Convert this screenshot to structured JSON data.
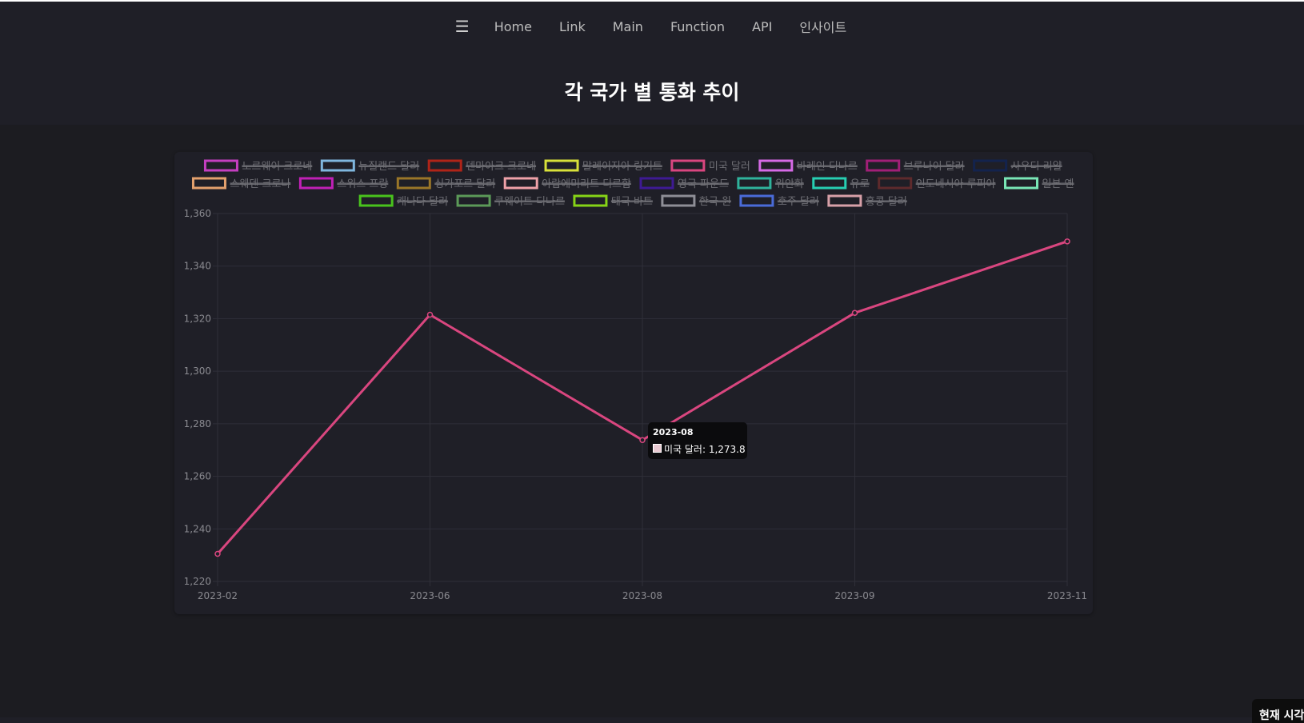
{
  "nav": {
    "menu_icon": "hamburger-menu-icon",
    "items": [
      "Home",
      "Link",
      "Main",
      "Function",
      "API",
      "인사이트"
    ]
  },
  "page": {
    "title": "각 국가 별 통화 추이"
  },
  "tooltip": {
    "title": "2023-08",
    "label": "미국 달러: 1,273.8"
  },
  "clock": {
    "label": "현재 시각"
  },
  "chart_data": {
    "type": "line",
    "x": [
      "2023-02",
      "2023-06",
      "2023-08",
      "2023-09",
      "2023-11"
    ],
    "ylim": [
      1220,
      1360
    ],
    "yticks": [
      "1,220",
      "1,240",
      "1,260",
      "1,280",
      "1,300",
      "1,320",
      "1,340",
      "1,360"
    ],
    "grid": true,
    "legend_position": "top",
    "legend": [
      {
        "name": "노르웨이 크로네",
        "color": "#c43fc0",
        "hidden": true
      },
      {
        "name": "뉴질랜드 달러",
        "color": "#7fb6dd",
        "hidden": true
      },
      {
        "name": "덴마아크 크로네",
        "color": "#b02418",
        "hidden": true
      },
      {
        "name": "말레이지아 링기트",
        "color": "#d8e13a",
        "hidden": true
      },
      {
        "name": "미국 달러",
        "color": "#d9467f",
        "hidden": false
      },
      {
        "name": "바레인 디나르",
        "color": "#d66ae6",
        "hidden": true
      },
      {
        "name": "브루나이 달러",
        "color": "#a11f77",
        "hidden": true
      },
      {
        "name": "사우디 리얄",
        "color": "#13234d",
        "hidden": true
      },
      {
        "name": "스웨덴 크로나",
        "color": "#e3a06d",
        "hidden": true
      },
      {
        "name": "스위스 프랑",
        "color": "#c020b6",
        "hidden": true
      },
      {
        "name": "싱가포르 달러",
        "color": "#9a7628",
        "hidden": true
      },
      {
        "name": "아랍에미리트 디르함",
        "color": "#eea1a8",
        "hidden": true
      },
      {
        "name": "영국 파운드",
        "color": "#3e1a93",
        "hidden": true
      },
      {
        "name": "위안화",
        "color": "#2fb39c",
        "hidden": true
      },
      {
        "name": "유로",
        "color": "#27ceb2",
        "hidden": true
      },
      {
        "name": "인도네시아 루피아",
        "color": "#5e2a2c",
        "hidden": true
      },
      {
        "name": "일본 옌",
        "color": "#79e6b6",
        "hidden": true
      },
      {
        "name": "캐나다 달러",
        "color": "#49c31d",
        "hidden": true
      },
      {
        "name": "쿠웨이트 디나르",
        "color": "#5c9a58",
        "hidden": true
      },
      {
        "name": "태국 바트",
        "color": "#86d317",
        "hidden": true
      },
      {
        "name": "한국 원",
        "color": "#8e8e96",
        "hidden": true
      },
      {
        "name": "호주 달러",
        "color": "#4a6bd8",
        "hidden": true
      },
      {
        "name": "홍콩 달러",
        "color": "#d7a0a8",
        "hidden": true
      }
    ],
    "series": [
      {
        "name": "미국 달러",
        "color": "#d9467f",
        "values": [
          1230.5,
          1321.5,
          1273.8,
          1322.2,
          1349.4
        ]
      }
    ]
  }
}
